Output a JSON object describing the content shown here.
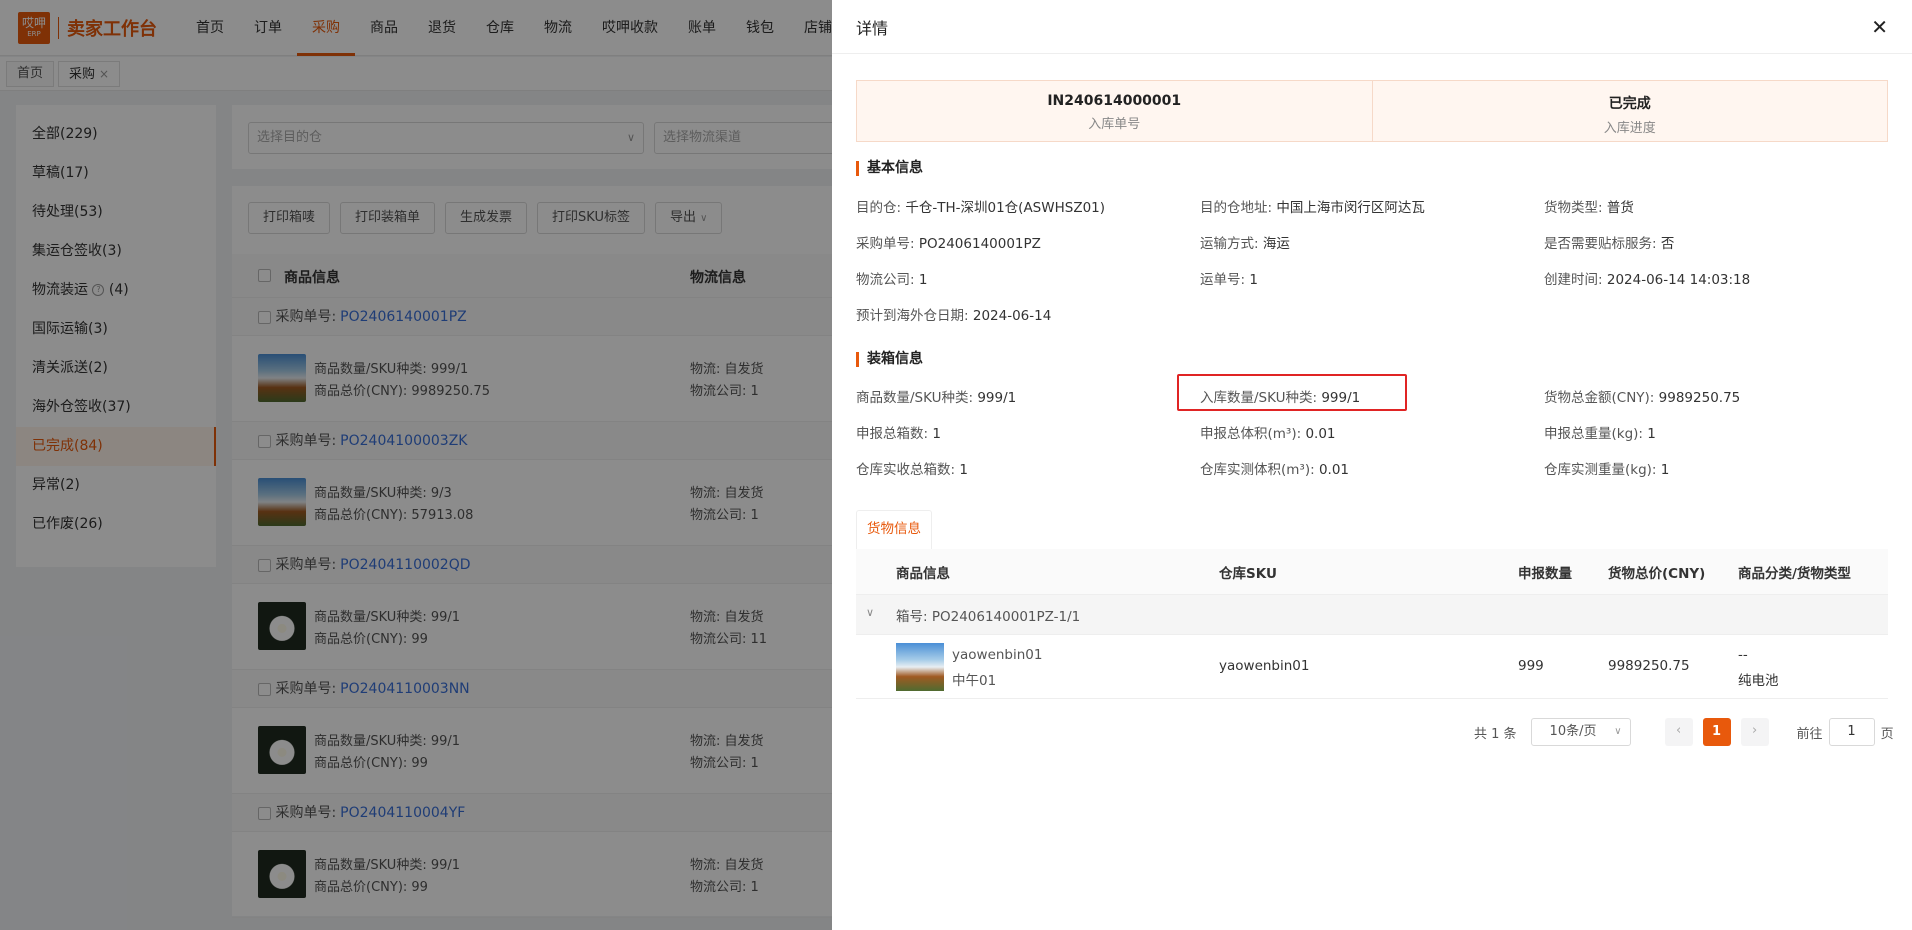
{
  "app": {
    "logo_top": "哎呷",
    "logo_sub": "ERP",
    "title": "卖家工作台"
  },
  "nav": [
    "首页",
    "订单",
    "采购",
    "商品",
    "退货",
    "仓库",
    "物流",
    "哎呷收款",
    "账单",
    "钱包",
    "店铺"
  ],
  "tabs": [
    {
      "label": "首页"
    },
    {
      "label": "采购",
      "close": "×"
    }
  ],
  "status_menu": [
    {
      "label": "全部(229)"
    },
    {
      "label": "草稿(17)"
    },
    {
      "label": "待处理(53)"
    },
    {
      "label": "集运仓签收(3)"
    },
    {
      "label": "物流装运",
      "hint": "?",
      "count": "(4)"
    },
    {
      "label": "国际运输(3)"
    },
    {
      "label": "清关派送(2)"
    },
    {
      "label": "海外仓签收(37)"
    },
    {
      "label": "已完成(84)"
    },
    {
      "label": "异常(2)"
    },
    {
      "label": "已作废(26)"
    }
  ],
  "filters": {
    "warehouse_placeholder": "选择目的仓",
    "channel_placeholder": "选择物流渠道"
  },
  "toolbar": [
    "打印箱唛",
    "打印装箱单",
    "生成发票",
    "打印SKU标签",
    "导出"
  ],
  "list_head": {
    "goods": "商品信息",
    "logistics": "物流信息"
  },
  "orders": [
    {
      "po_label": "采购单号:",
      "po": "PO2406140001PZ",
      "qty": "商品数量/SKU种类:  999/1",
      "total": "商品总价(CNY):  9989250.75",
      "logi": "物流:   自发货",
      "company": "物流公司:  1"
    },
    {
      "po_label": "采购单号:",
      "po": "PO2404100003ZK",
      "qty": "商品数量/SKU种类:  9/3",
      "total": "商品总价(CNY):  57913.08",
      "logi": "物流:   自发货",
      "company": "物流公司:  1"
    },
    {
      "po_label": "采购单号:",
      "po": "PO2404110002QD",
      "qty": "商品数量/SKU种类:  99/1",
      "total": "商品总价(CNY):  99",
      "logi": "物流:   自发货",
      "company": "物流公司:  11"
    },
    {
      "po_label": "采购单号:",
      "po": "PO2404110003NN",
      "qty": "商品数量/SKU种类:  99/1",
      "total": "商品总价(CNY):  99",
      "logi": "物流:   自发货",
      "company": "物流公司:  1"
    },
    {
      "po_label": "采购单号:",
      "po": "PO2404110004YF",
      "qty": "商品数量/SKU种类:  99/1",
      "total": "商品总价(CNY):  99",
      "logi": "物流:   自发货",
      "company": "物流公司:  1"
    }
  ],
  "drawer": {
    "title": "详情",
    "close": "✕",
    "summary": [
      {
        "value": "IN240614000001",
        "label": "入库单号"
      },
      {
        "value": "已完成",
        "label": "入库进度"
      }
    ],
    "basic_title": "基本信息",
    "basic": [
      {
        "k": "目的仓:",
        "v": "千仓-TH-深圳01仓(ASWHSZ01)"
      },
      {
        "k": "目的仓地址:",
        "v": "中国上海市闵行区阿达瓦"
      },
      {
        "k": "货物类型:",
        "v": "普货"
      },
      {
        "k": "采购单号:",
        "v": "PO2406140001PZ"
      },
      {
        "k": "运输方式:",
        "v": "海运"
      },
      {
        "k": "是否需要贴标服务:",
        "v": "否"
      },
      {
        "k": "物流公司:",
        "v": "1"
      },
      {
        "k": "运单号:",
        "v": "1"
      },
      {
        "k": "创建时间:",
        "v": "2024-06-14 14:03:18"
      },
      {
        "k": "预计到海外仓日期:",
        "v": "2024-06-14"
      }
    ],
    "packing_title": "装箱信息",
    "packing": [
      {
        "k": "商品数量/SKU种类:",
        "v": "999/1"
      },
      {
        "k": "入库数量/SKU种类:",
        "v": "999/1"
      },
      {
        "k": "货物总金额(CNY):",
        "v": "9989250.75"
      },
      {
        "k": "申报总箱数:",
        "v": "1"
      },
      {
        "k": "申报总体积(m³):",
        "v": "0.01"
      },
      {
        "k": "申报总重量(kg):",
        "v": "1"
      },
      {
        "k": "仓库实收总箱数:",
        "v": "1"
      },
      {
        "k": "仓库实测体积(m³):",
        "v": "0.01"
      },
      {
        "k": "仓库实测重量(kg):",
        "v": "1"
      }
    ],
    "goods_tab": "货物信息",
    "goods_head": {
      "info": "商品信息",
      "sku": "仓库SKU",
      "qty": "申报数量",
      "total": "货物总价(CNY)",
      "type": "商品分类/货物类型"
    },
    "box_label": "箱号: PO2406140001PZ-1/1",
    "goods_row": {
      "name": "yaowenbin01",
      "spec": "中午01",
      "sku": "yaowenbin01",
      "qty": "999",
      "total": "9989250.75",
      "cat": "--",
      "cargo": "纯电池"
    },
    "pager": {
      "total": "共 1 条",
      "size": "10条/页",
      "current": "1",
      "goto_label": "前往",
      "goto_value": "1",
      "page_unit": "页",
      "prev": "‹",
      "next": "›"
    }
  },
  "colors": {
    "accent": "#e8590c",
    "link": "#3a6fd8",
    "highlight": "#e02424"
  }
}
